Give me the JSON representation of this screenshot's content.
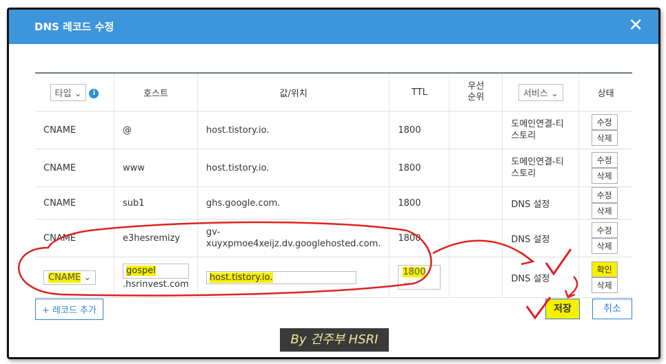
{
  "dialog": {
    "title": "DNS 레코드 수정",
    "close_glyph": "✕"
  },
  "table": {
    "headers": {
      "type_select": "타입",
      "type_chevron": "⌄",
      "info": "i",
      "host": "호스트",
      "value": "값/위치",
      "ttl": "TTL",
      "priority": "우선\n순위",
      "service_select": "서비스",
      "service_chevron": "⌄",
      "status": "상태"
    },
    "rows": [
      {
        "type": "CNAME",
        "host": "@",
        "value": "host.tistory.io.",
        "ttl": "1800",
        "priority": "",
        "service": "도메인연결-티\n스토리",
        "edit": "수정",
        "delete": "삭제"
      },
      {
        "type": "CNAME",
        "host": "www",
        "value": "host.tistory.io.",
        "ttl": "1800",
        "priority": "",
        "service": "도메인연결-티\n스토리",
        "edit": "수정",
        "delete": "삭제"
      },
      {
        "type": "CNAME",
        "host": "sub1",
        "value": "ghs.google.com.",
        "ttl": "1800",
        "priority": "",
        "service": "DNS 설정",
        "edit": "수정",
        "delete": "삭제"
      },
      {
        "type": "CNAME",
        "host": "e3hesremizy",
        "value": "gv-\nxuyxpmoe4xeijz.dv.googlehosted.com.",
        "ttl": "1800",
        "priority": "",
        "service": "DNS 설정",
        "edit": "수정",
        "delete": "삭제"
      }
    ],
    "edit_row": {
      "type_value": "CNAME",
      "type_chevron": "⌄",
      "host_value": "gospel",
      "host_suffix": ".hsrinvest.com",
      "value_value": "host.tistory.io.",
      "ttl_value": "1800",
      "ttl_chevron": "⌄",
      "service": "DNS 설정",
      "confirm": "확인",
      "delete": "삭제"
    }
  },
  "footer": {
    "add_record": "+ 레코드 추가",
    "save": "저장",
    "cancel": "취소"
  },
  "watermark": "By 건주부 HSRI",
  "colors": {
    "header": "#3d95db",
    "highlight": "#f6f000",
    "annotation": "#e02020",
    "accent": "#2f7fd0"
  }
}
